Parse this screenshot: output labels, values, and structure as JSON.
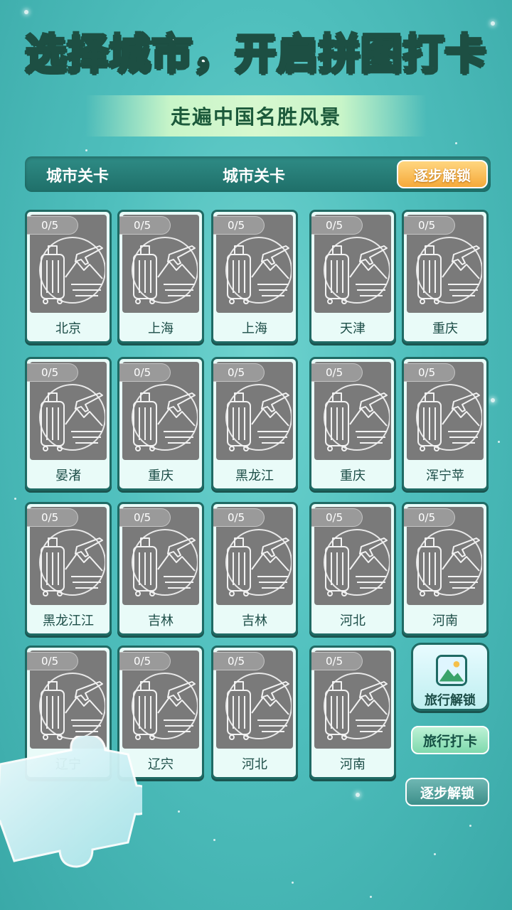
{
  "title": "选择城市，开启拼图打卡",
  "subtitle": "走遍中国名胜风景",
  "header": {
    "left_label": "城市关卡",
    "center_label": "城市关卡",
    "unlock_button": "逐步解锁"
  },
  "cards": [
    {
      "progress": "0/5",
      "name": "北京"
    },
    {
      "progress": "0/5",
      "name": "上海"
    },
    {
      "progress": "0/5",
      "name": "上海"
    },
    {
      "progress": "0/5",
      "name": "天津"
    },
    {
      "progress": "0/5",
      "name": "重庆"
    },
    {
      "progress": "0/5",
      "name": "晏渚"
    },
    {
      "progress": "0/5",
      "name": "重庆"
    },
    {
      "progress": "0/5",
      "name": "黑龙江"
    },
    {
      "progress": "0/5",
      "name": "重庆"
    },
    {
      "progress": "0/5",
      "name": "浑宁苹"
    },
    {
      "progress": "0/5",
      "name": "黑龙江江"
    },
    {
      "progress": "0/5",
      "name": "吉林"
    },
    {
      "progress": "0/5",
      "name": "吉林"
    },
    {
      "progress": "0/5",
      "name": "河北"
    },
    {
      "progress": "0/5",
      "name": "河南"
    },
    {
      "progress": "0/5",
      "name": "辽宁"
    },
    {
      "progress": "0/5",
      "name": "辽宍"
    },
    {
      "progress": "0/5",
      "name": "河北"
    },
    {
      "progress": "0/5",
      "name": "河南"
    }
  ],
  "side": {
    "travel_unlock": "旅行解锁",
    "travel_checkin": "旅行打卡",
    "step_unlock": "逐步解锁"
  },
  "icons": {
    "card_icon": "suitcase-plane-mountain-icon",
    "side_icon": "picture-icon"
  },
  "colors": {
    "background": "#4fbfbd",
    "card_border": "#1f6a64",
    "locked_image": "#7a7a7a",
    "accent_orange": "#f5a93a",
    "accent_green": "#7fd9ad"
  }
}
